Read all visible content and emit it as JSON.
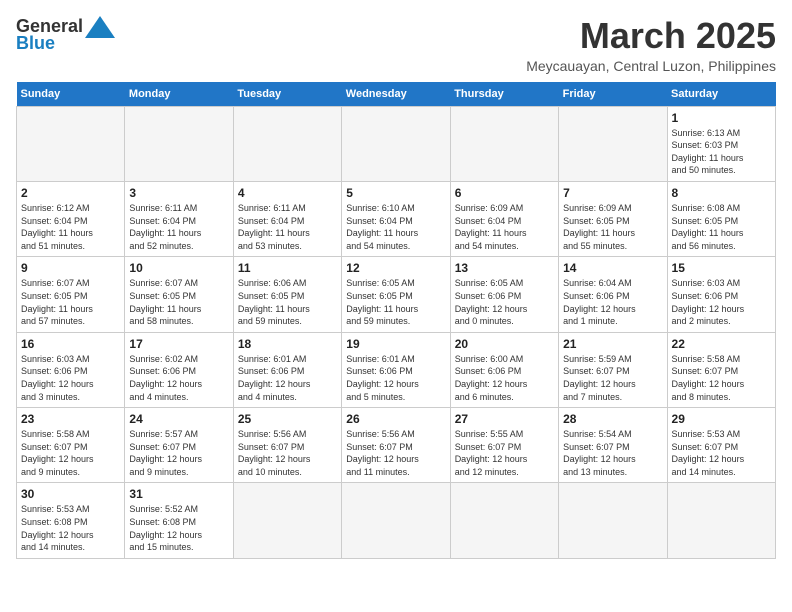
{
  "header": {
    "logo_general": "General",
    "logo_blue": "Blue",
    "month_title": "March 2025",
    "location": "Meycauayan, Central Luzon, Philippines"
  },
  "weekdays": [
    "Sunday",
    "Monday",
    "Tuesday",
    "Wednesday",
    "Thursday",
    "Friday",
    "Saturday"
  ],
  "weeks": [
    [
      {
        "day": "",
        "info": ""
      },
      {
        "day": "",
        "info": ""
      },
      {
        "day": "",
        "info": ""
      },
      {
        "day": "",
        "info": ""
      },
      {
        "day": "",
        "info": ""
      },
      {
        "day": "",
        "info": ""
      },
      {
        "day": "1",
        "info": "Sunrise: 6:13 AM\nSunset: 6:03 PM\nDaylight: 11 hours\nand 50 minutes."
      }
    ],
    [
      {
        "day": "2",
        "info": "Sunrise: 6:12 AM\nSunset: 6:04 PM\nDaylight: 11 hours\nand 51 minutes."
      },
      {
        "day": "3",
        "info": "Sunrise: 6:11 AM\nSunset: 6:04 PM\nDaylight: 11 hours\nand 52 minutes."
      },
      {
        "day": "4",
        "info": "Sunrise: 6:11 AM\nSunset: 6:04 PM\nDaylight: 11 hours\nand 53 minutes."
      },
      {
        "day": "5",
        "info": "Sunrise: 6:10 AM\nSunset: 6:04 PM\nDaylight: 11 hours\nand 54 minutes."
      },
      {
        "day": "6",
        "info": "Sunrise: 6:09 AM\nSunset: 6:04 PM\nDaylight: 11 hours\nand 54 minutes."
      },
      {
        "day": "7",
        "info": "Sunrise: 6:09 AM\nSunset: 6:05 PM\nDaylight: 11 hours\nand 55 minutes."
      },
      {
        "day": "8",
        "info": "Sunrise: 6:08 AM\nSunset: 6:05 PM\nDaylight: 11 hours\nand 56 minutes."
      }
    ],
    [
      {
        "day": "9",
        "info": "Sunrise: 6:07 AM\nSunset: 6:05 PM\nDaylight: 11 hours\nand 57 minutes."
      },
      {
        "day": "10",
        "info": "Sunrise: 6:07 AM\nSunset: 6:05 PM\nDaylight: 11 hours\nand 58 minutes."
      },
      {
        "day": "11",
        "info": "Sunrise: 6:06 AM\nSunset: 6:05 PM\nDaylight: 11 hours\nand 59 minutes."
      },
      {
        "day": "12",
        "info": "Sunrise: 6:05 AM\nSunset: 6:05 PM\nDaylight: 11 hours\nand 59 minutes."
      },
      {
        "day": "13",
        "info": "Sunrise: 6:05 AM\nSunset: 6:06 PM\nDaylight: 12 hours\nand 0 minutes."
      },
      {
        "day": "14",
        "info": "Sunrise: 6:04 AM\nSunset: 6:06 PM\nDaylight: 12 hours\nand 1 minute."
      },
      {
        "day": "15",
        "info": "Sunrise: 6:03 AM\nSunset: 6:06 PM\nDaylight: 12 hours\nand 2 minutes."
      }
    ],
    [
      {
        "day": "16",
        "info": "Sunrise: 6:03 AM\nSunset: 6:06 PM\nDaylight: 12 hours\nand 3 minutes."
      },
      {
        "day": "17",
        "info": "Sunrise: 6:02 AM\nSunset: 6:06 PM\nDaylight: 12 hours\nand 4 minutes."
      },
      {
        "day": "18",
        "info": "Sunrise: 6:01 AM\nSunset: 6:06 PM\nDaylight: 12 hours\nand 4 minutes."
      },
      {
        "day": "19",
        "info": "Sunrise: 6:01 AM\nSunset: 6:06 PM\nDaylight: 12 hours\nand 5 minutes."
      },
      {
        "day": "20",
        "info": "Sunrise: 6:00 AM\nSunset: 6:06 PM\nDaylight: 12 hours\nand 6 minutes."
      },
      {
        "day": "21",
        "info": "Sunrise: 5:59 AM\nSunset: 6:07 PM\nDaylight: 12 hours\nand 7 minutes."
      },
      {
        "day": "22",
        "info": "Sunrise: 5:58 AM\nSunset: 6:07 PM\nDaylight: 12 hours\nand 8 minutes."
      }
    ],
    [
      {
        "day": "23",
        "info": "Sunrise: 5:58 AM\nSunset: 6:07 PM\nDaylight: 12 hours\nand 9 minutes."
      },
      {
        "day": "24",
        "info": "Sunrise: 5:57 AM\nSunset: 6:07 PM\nDaylight: 12 hours\nand 9 minutes."
      },
      {
        "day": "25",
        "info": "Sunrise: 5:56 AM\nSunset: 6:07 PM\nDaylight: 12 hours\nand 10 minutes."
      },
      {
        "day": "26",
        "info": "Sunrise: 5:56 AM\nSunset: 6:07 PM\nDaylight: 12 hours\nand 11 minutes."
      },
      {
        "day": "27",
        "info": "Sunrise: 5:55 AM\nSunset: 6:07 PM\nDaylight: 12 hours\nand 12 minutes."
      },
      {
        "day": "28",
        "info": "Sunrise: 5:54 AM\nSunset: 6:07 PM\nDaylight: 12 hours\nand 13 minutes."
      },
      {
        "day": "29",
        "info": "Sunrise: 5:53 AM\nSunset: 6:07 PM\nDaylight: 12 hours\nand 14 minutes."
      }
    ],
    [
      {
        "day": "30",
        "info": "Sunrise: 5:53 AM\nSunset: 6:08 PM\nDaylight: 12 hours\nand 14 minutes."
      },
      {
        "day": "31",
        "info": "Sunrise: 5:52 AM\nSunset: 6:08 PM\nDaylight: 12 hours\nand 15 minutes."
      },
      {
        "day": "",
        "info": ""
      },
      {
        "day": "",
        "info": ""
      },
      {
        "day": "",
        "info": ""
      },
      {
        "day": "",
        "info": ""
      },
      {
        "day": "",
        "info": ""
      }
    ]
  ]
}
